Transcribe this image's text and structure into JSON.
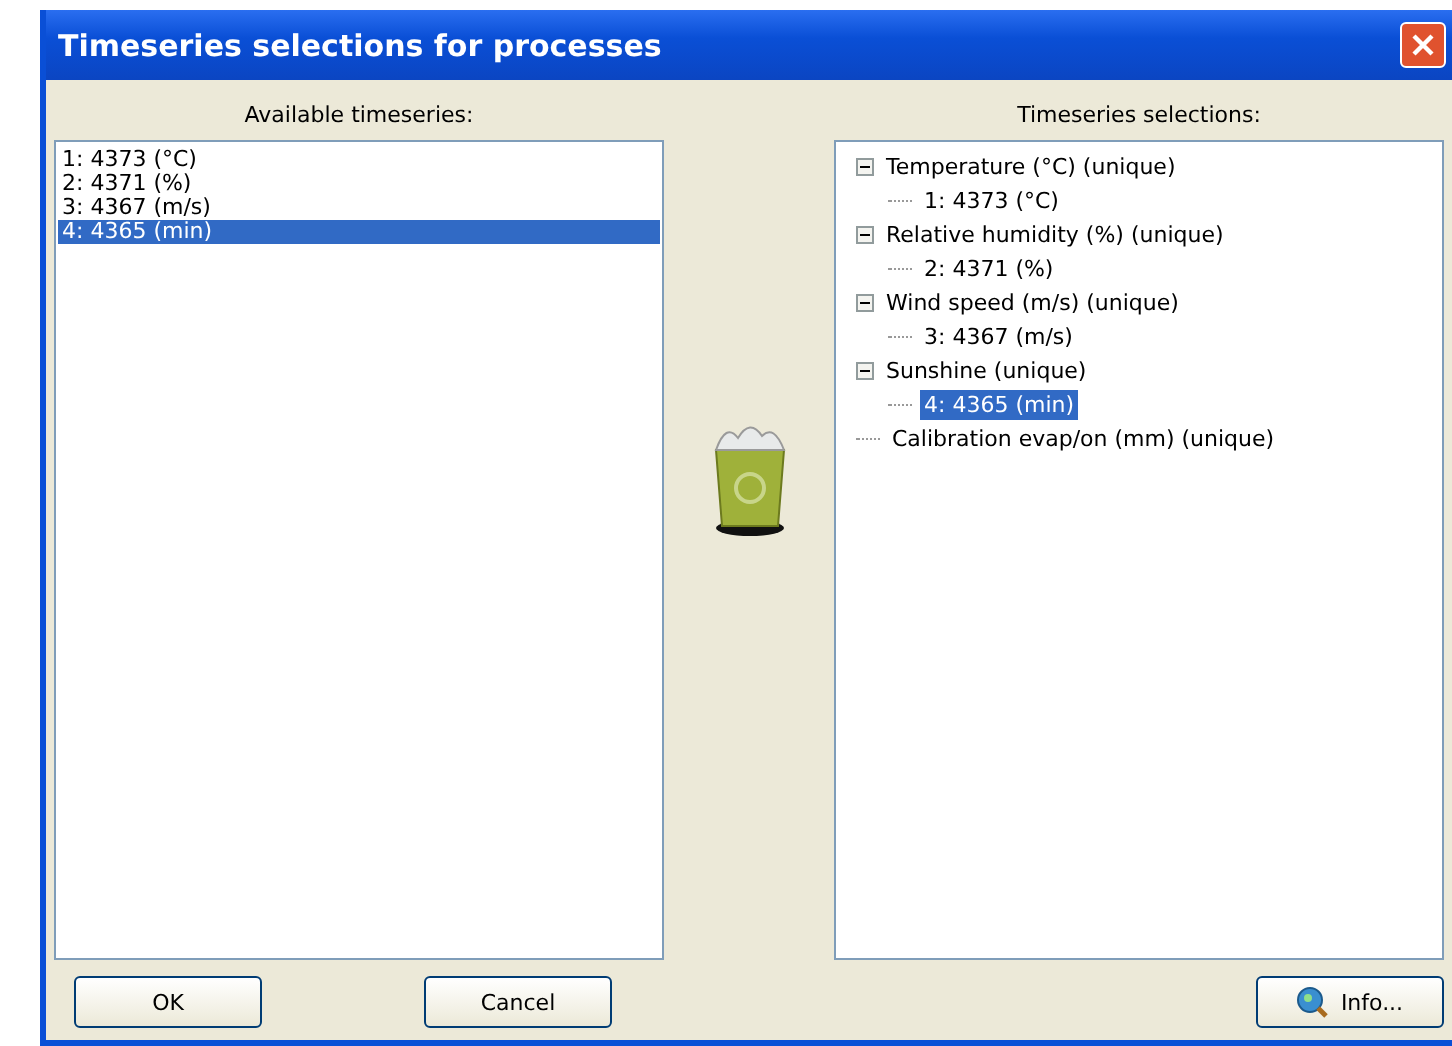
{
  "window": {
    "title": "Timeseries selections for processes"
  },
  "available": {
    "label": "Available timeseries:",
    "items": [
      {
        "text": "1: 4373 (°C)",
        "selected": false
      },
      {
        "text": "2: 4371 (%)",
        "selected": false
      },
      {
        "text": "3: 4367 (m/s)",
        "selected": false
      },
      {
        "text": "4: 4365 (min)",
        "selected": true
      }
    ]
  },
  "selections": {
    "label": "Timeseries selections:",
    "tree": [
      {
        "text": "Temperature (°C) (unique)",
        "selected": false,
        "expanded": true,
        "children": [
          {
            "text": "1: 4373 (°C)",
            "selected": false
          }
        ]
      },
      {
        "text": "Relative humidity (%) (unique)",
        "selected": false,
        "expanded": true,
        "children": [
          {
            "text": "2: 4371 (%)",
            "selected": false
          }
        ]
      },
      {
        "text": "Wind speed (m/s) (unique)",
        "selected": false,
        "expanded": true,
        "children": [
          {
            "text": "3: 4367 (m/s)",
            "selected": false
          }
        ]
      },
      {
        "text": "Sunshine (unique)",
        "selected": false,
        "expanded": true,
        "children": [
          {
            "text": "4: 4365 (min)",
            "selected": true
          }
        ]
      },
      {
        "text": "Calibration evap/on (mm) (unique)",
        "selected": false,
        "expanded": false
      }
    ]
  },
  "buttons": {
    "ok": "OK",
    "cancel": "Cancel",
    "info": "Info..."
  }
}
